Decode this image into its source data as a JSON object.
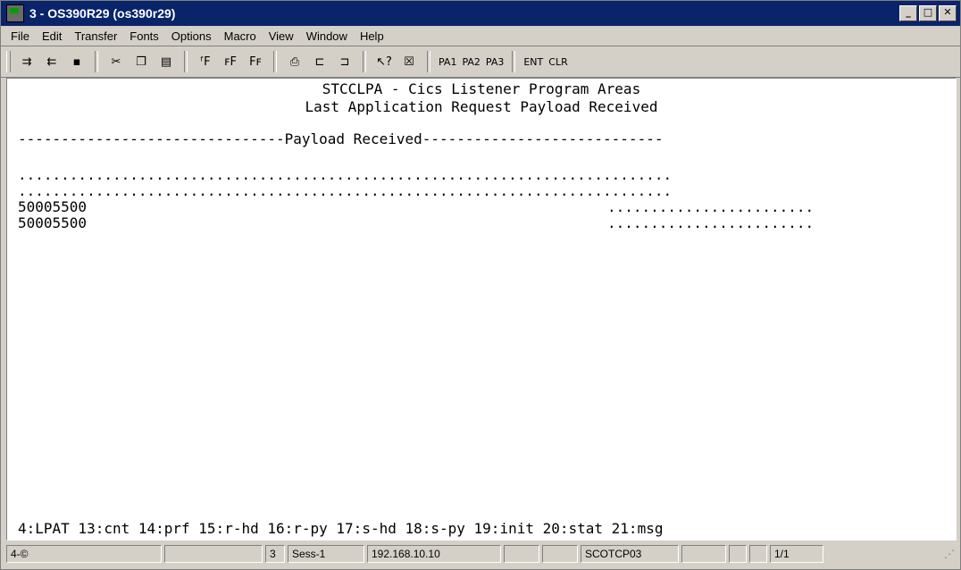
{
  "window": {
    "title": "3 - OS390R29 (os390r29)"
  },
  "menu": [
    "File",
    "Edit",
    "Transfer",
    "Fonts",
    "Options",
    "Macro",
    "View",
    "Window",
    "Help"
  ],
  "toolbar": {
    "pa1": "PA1",
    "pa2": "PA2",
    "pa3": "PA3",
    "ent": "ENT",
    "clr": "CLR"
  },
  "screen": {
    "header1": "STCCLPA - Cics Listener Program Areas",
    "header2": "Last Application Request Payload Received",
    "section": "-------------------------------Payload Received----------------------------",
    "dots1": "............................................................................",
    "dots2": "............................................................................",
    "row1_hex": "50005500",
    "row1_dots": "........................",
    "row2_hex": "50005500",
    "row2_dots": "........................",
    "pf_keys": "4:LPAT 13:cnt 14:prf 15:r-hd 16:r-py 17:s-hd 18:s-py 19:init 20:stat 21:msg"
  },
  "status": {
    "p1": "4-©",
    "p2": "",
    "p3": "3",
    "p4": "Sess-1",
    "p5": "192.168.10.10",
    "p6": "",
    "p7": "",
    "p8": "SCOTCP03",
    "p9": "",
    "p10": "",
    "p11": "",
    "p12": "1/1"
  }
}
